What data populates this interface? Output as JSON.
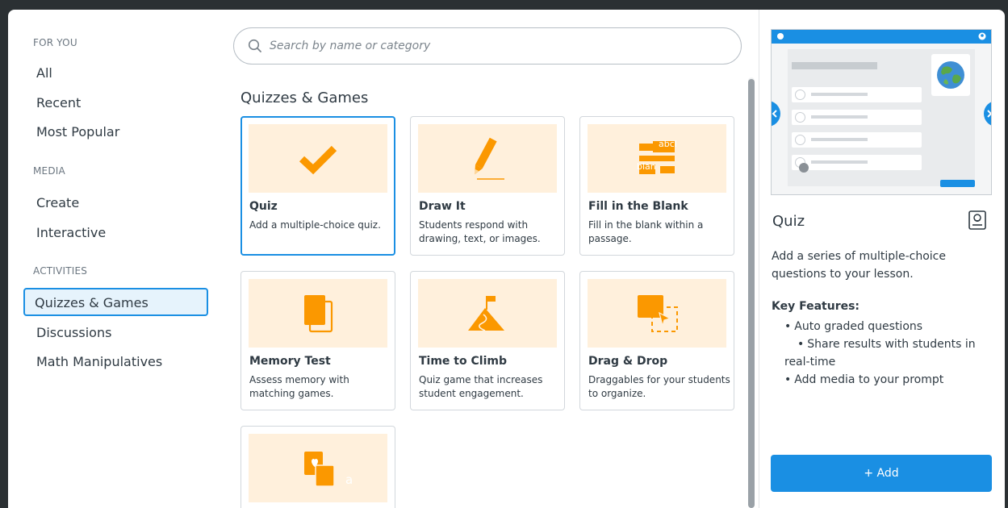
{
  "sidebar": {
    "sections": [
      {
        "heading": "FOR YOU",
        "items": [
          "All",
          "Recent",
          "Most Popular"
        ]
      },
      {
        "heading": "MEDIA",
        "items": [
          "Create",
          "Interactive"
        ]
      },
      {
        "heading": "ACTIVITIES",
        "items": [
          "Quizzes & Games",
          "Discussions",
          "Math Manipulatives"
        ]
      }
    ],
    "active_item": "Quizzes & Games"
  },
  "search": {
    "placeholder": "Search by name or category",
    "value": ""
  },
  "main": {
    "section_title": "Quizzes & Games",
    "cards": [
      {
        "title": "Quiz",
        "description": "Add a multiple-choice quiz.",
        "icon": "checkmark-icon",
        "selected": true
      },
      {
        "title": "Draw It",
        "description": "Students respond with drawing, text, or images.",
        "icon": "pencil-icon",
        "selected": false
      },
      {
        "title": "Fill in the Blank",
        "description": "Fill in the blank within a passage.",
        "icon": "fill-blank-icon",
        "icon_text": [
          "abcl",
          "blan"
        ],
        "selected": false
      },
      {
        "title": "Memory Test",
        "description": "Assess memory with matching games.",
        "icon": "memory-cards-icon",
        "selected": false
      },
      {
        "title": "Time to Climb",
        "description": "Quiz game that increases student engagement.",
        "icon": "mountain-flag-icon",
        "selected": false
      },
      {
        "title": "Drag & Drop",
        "description": "Draggables for your students to organize.",
        "icon": "drag-drop-icon",
        "selected": false
      },
      {
        "title": "",
        "description": "",
        "icon": "matching-icon",
        "icon_text": [
          "a"
        ],
        "selected": false
      }
    ]
  },
  "detail": {
    "title": "Quiz",
    "description": "Add a series of multiple-choice questions to your lesson.",
    "key_features_label": "Key Features:",
    "features": [
      "Auto graded questions",
      "Share results with students in real-time",
      "Add media to your prompt"
    ],
    "add_button": "+ Add"
  },
  "colors": {
    "accent": "#1a8fe3",
    "icon_orange": "#fb9800",
    "thumb_bg": "#fff0dc",
    "active_bg": "#e6f3fc"
  }
}
